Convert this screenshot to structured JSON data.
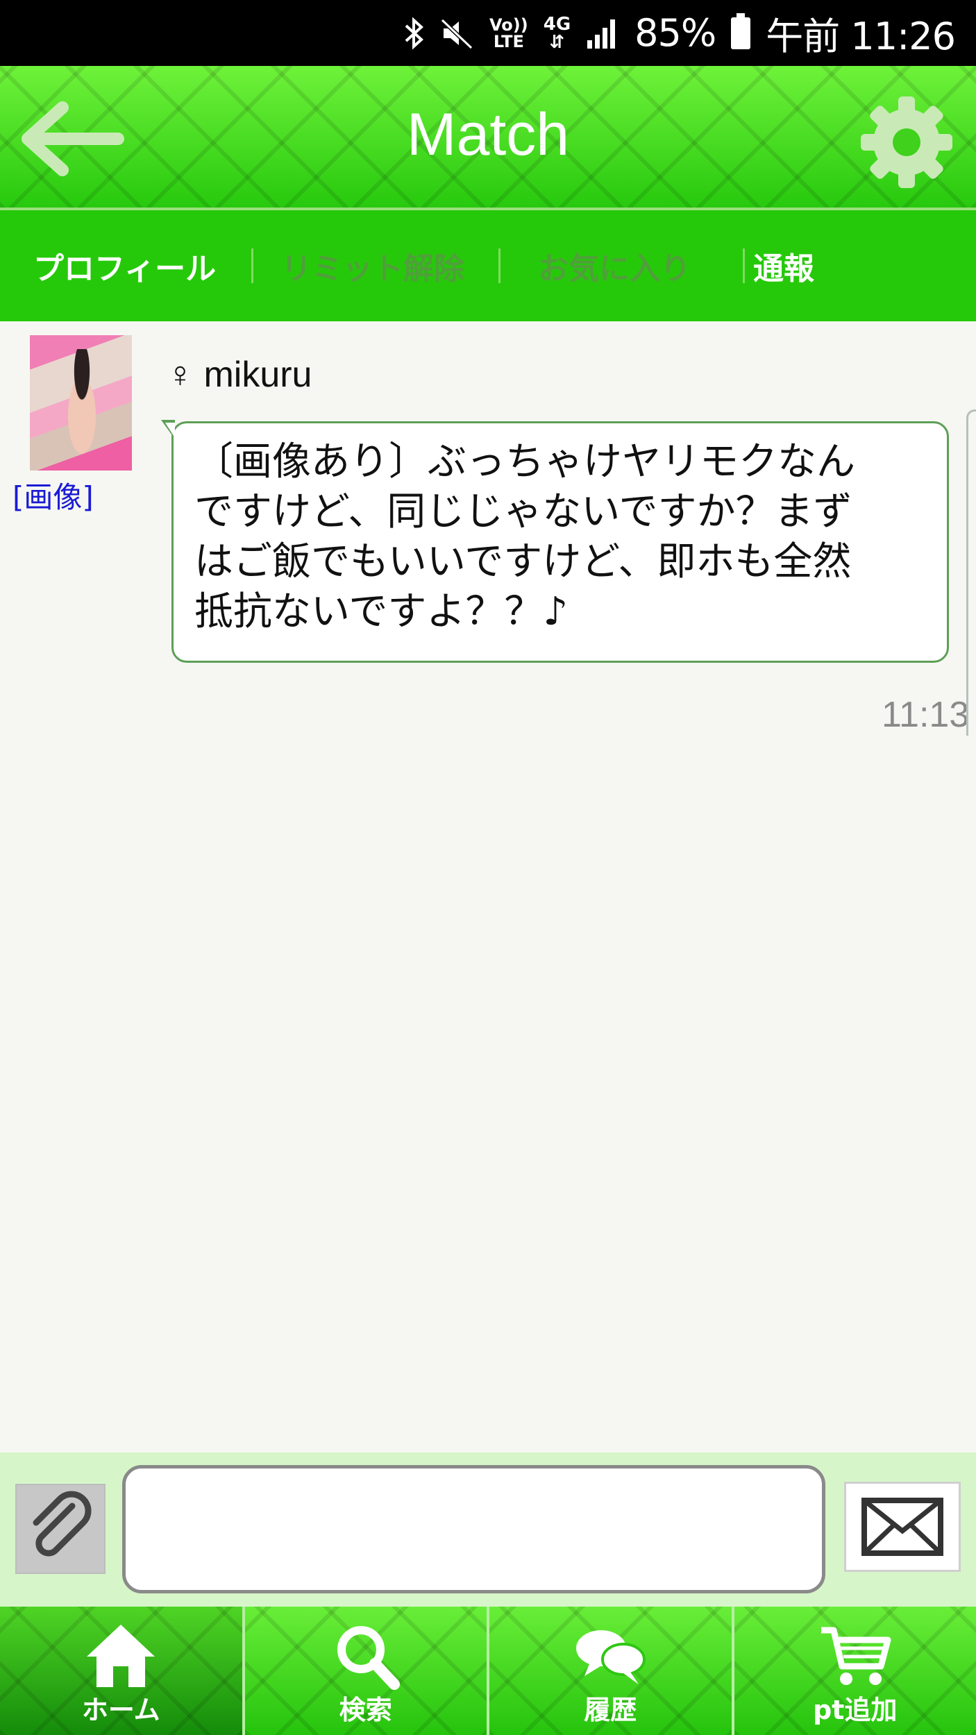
{
  "status_bar": {
    "lte_top": "Vo))",
    "lte_bottom": "LTE",
    "network": "4G",
    "battery": "85%",
    "time": "午前 11:26",
    "icons": [
      "bluetooth-icon",
      "mute-icon",
      "volte-icon",
      "4g-icon",
      "signal-icon",
      "battery-icon"
    ]
  },
  "header": {
    "title": "Match",
    "back_icon": "back-arrow-icon",
    "settings_icon": "gear-icon"
  },
  "tabs": [
    {
      "label": "プロフィール",
      "enabled": true
    },
    {
      "label": "リミット解除",
      "enabled": false
    },
    {
      "label": "お気に入り",
      "enabled": false
    },
    {
      "label": "通報",
      "enabled": true
    }
  ],
  "message": {
    "sender_symbol": "♀",
    "sender_name": "mikuru",
    "image_link": "[画像]",
    "lines": [
      "〔画像あり〕ぶっちゃけヤリモクなん",
      "ですけど、同じじゃないですか？まず",
      "はご飯でもいいですけど、即ホも全然",
      "抵抗ないですよ？？♪"
    ],
    "time": "11:13"
  },
  "compose": {
    "input_value": "",
    "attach_icon": "paperclip-icon",
    "send_icon": "envelope-icon"
  },
  "bottom_nav": [
    {
      "label": "ホーム",
      "icon": "home-icon",
      "active": true
    },
    {
      "label": "検索",
      "icon": "search-icon",
      "active": false
    },
    {
      "label": "履歴",
      "icon": "chat-bubbles-icon",
      "active": false
    },
    {
      "label": "pt追加",
      "icon": "cart-icon",
      "active": false
    }
  ],
  "colors": {
    "brand_green": "#26c90a",
    "bubble_border": "#5d9f57",
    "link_blue": "#1a1ad6"
  }
}
